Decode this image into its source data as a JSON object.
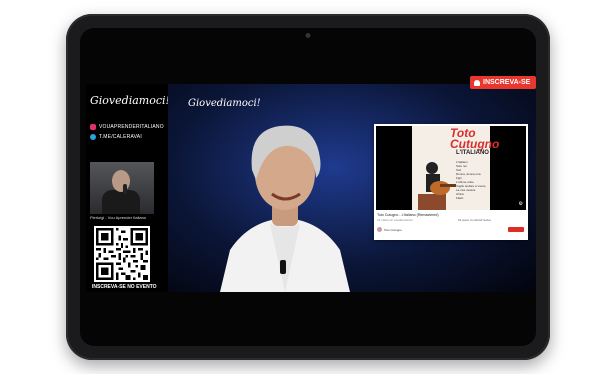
{
  "brand": "Giovediamoci!",
  "social": [
    {
      "label": "VOUAPRENDERITALIANO",
      "icon": "instagram-icon",
      "color": "#e1306c"
    },
    {
      "label": "T.ME/CALERAVAI",
      "icon": "telegram-icon",
      "color": "#2aa3e0"
    }
  ],
  "webcam_label": "Pierluigi - Vou Aprender Italiano",
  "qr_label": "INSCREVA-SE NO EVENTO",
  "subscribe_label": "INSCREVA-SE",
  "video": {
    "album_artist": "Toto Cutugno",
    "album_title": "L'ITALIANO",
    "tracks": [
      "L'italiano",
      "Solo noi",
      "Soli",
      "Donna, donna mia",
      "Figli",
      "L'ultima notte",
      "Voglio andare a vivere",
      "La mia musica",
      "Africa",
      "Flash"
    ],
    "title": "Toto Cutugno - L'italiano (Remastered)",
    "meta": "19 milioni di visualizzazioni",
    "channel": "Toto Cutugno",
    "actions": "Mi piace   Condividi   Salva"
  },
  "colors": {
    "accent": "#e9372f",
    "stage": "#1f3b8f"
  }
}
